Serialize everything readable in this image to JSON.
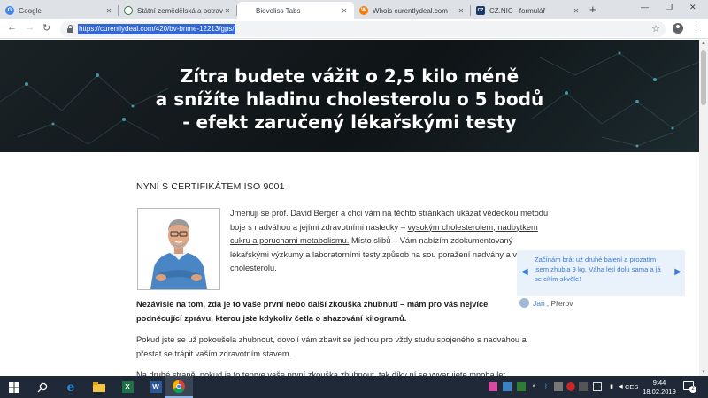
{
  "browser": {
    "tabs": [
      {
        "title": "Google",
        "icon": "google-favicon-icon",
        "color": "#4285f4"
      },
      {
        "title": "Státní zemědělská a potrav",
        "icon": "szpi-favicon-icon",
        "color": "#2e7d32"
      },
      {
        "title": "Bioveliss Tabs",
        "icon": "blank-favicon-icon",
        "color": "#ffffff"
      },
      {
        "title": "Whois curentlydeal.com",
        "icon": "whois-favicon-icon",
        "color": "#f57c00"
      },
      {
        "title": "CZ.NIC - formulář",
        "icon": "cznic-favicon-icon",
        "color": "#1a3a6b"
      }
    ],
    "new_tab_symbol": "+",
    "url": "https://curentlydeal.com/420/bv-bnme-12213/gps/"
  },
  "page": {
    "hero_lines": [
      "Zítra budete vážit o 2,5 kilo méně",
      "a snížíte hladinu cholesterolu o 5 bodů",
      "- efekt zaručený lékařskými testy"
    ],
    "certificate_heading": "NYNÍ S CERTIFIKÁTEM ISO 9001",
    "intro": {
      "t1": "Jmenuji se prof. David Berger a chci vám na těchto stránkách ukázat vědeckou metodu boje s nadváhou a jejími zdravotními následky – ",
      "u1": "vysokým cholesterolem, nadbytkem cukru a poruchami metabolismu.",
      "t2": " Místo slibů – Vám nabízím zdokumentovaný lékařskými výzkumy a laboratorními testy způsob na sou poražení nadváhy a vysokého cholesterolu."
    },
    "bold_paragraph": "Nezávisle na tom, zda je to vaše první nebo další zkouška zhubnutí – mám pro vás nejvíce podněcující zprávu, kterou jste kdykoliv četla o shazování kilogramů.",
    "paragraph2": "Pokud jste se už pokoušela zhubnout, dovolí vám zbavit se jednou pro vždy studu spojeného s nadváhou a přestat se trápit vaším zdravotním stavem.",
    "paragraph3": "Na druhé straně, pokud je to teprve vaše první zkouška zhubnout, tak díky ní se vyvarujete mnoha let",
    "testimonial": {
      "text": "Začínám brát už druhé balení a prozatím jsem zhubla 9 kg. Váha letí dolu sama a já se cítím skvěle!",
      "author": "Jan",
      "city": ", Přerov"
    }
  },
  "taskbar": {
    "language": "CES",
    "time": "9:44",
    "date": "18.02.2019",
    "notification_count": "2",
    "apps": [
      "windows-start-icon",
      "search-icon",
      "edge-icon",
      "file-explorer-icon",
      "excel-icon",
      "word-icon",
      "chrome-icon"
    ]
  }
}
